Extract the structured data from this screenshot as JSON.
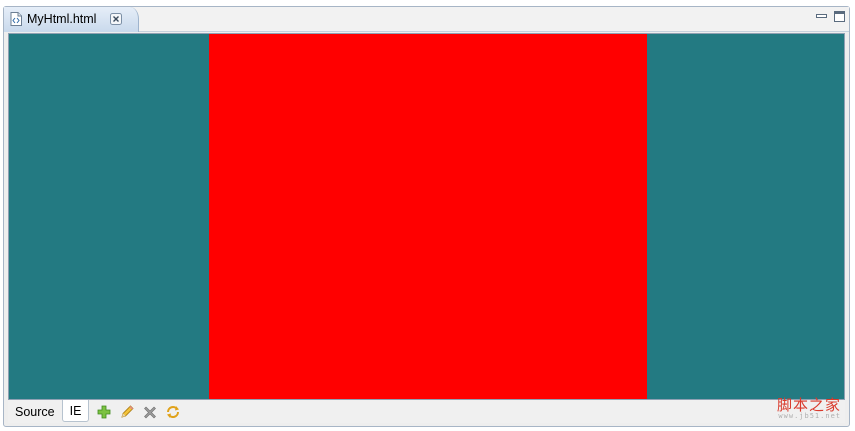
{
  "editor": {
    "tab_label": "MyHtml.html"
  },
  "content": {
    "background_color": "#237a82",
    "block_color": "#ff0000"
  },
  "bottom_tabs": [
    {
      "label": "Source",
      "active": false
    },
    {
      "label": "IE",
      "active": true
    }
  ],
  "toolbar_icons": [
    "add-icon",
    "edit-pencil-icon",
    "delete-icon",
    "refresh-icon"
  ],
  "watermark": {
    "main": "脚本之家",
    "sub": "www.jb51.net"
  }
}
